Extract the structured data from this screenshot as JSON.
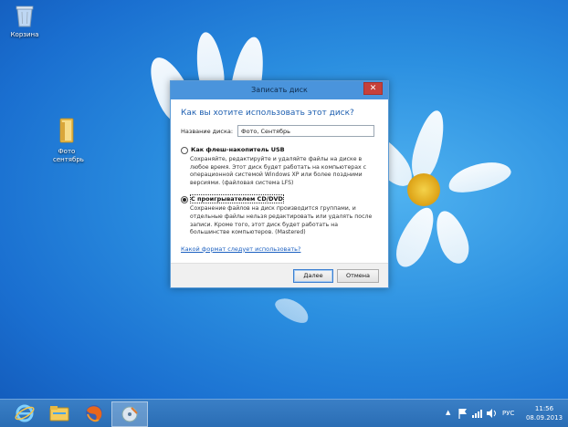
{
  "desktop": {
    "icons": [
      {
        "label": "Корзина",
        "icon": "recycle-bin-icon"
      },
      {
        "label": "Фото сентябрь",
        "icon": "folder-icon"
      }
    ]
  },
  "dialog": {
    "title": "Записать диск",
    "close_label": "✕",
    "heading": "Как вы хотите использовать этот диск?",
    "disc_name_label": "Название диска:",
    "disc_name_value": "Фото, Сентябрь",
    "option_usb": {
      "title": "Как флеш-накопитель USB",
      "description": "Сохраняйте, редактируйте и удаляйте файлы на диске в любое время. Этот диск будет работать на компьютерах с операционной системой Windows XP или более поздними версиями. (файловая система LFS)",
      "selected": false
    },
    "option_cd": {
      "title": "С проигрывателем CD/DVD",
      "description": "Сохранение файлов на диск производится группами, и отдельные файлы нельзя редактировать или удалять после записи. Кроме того, этот диск будет работать на большинстве компьютеров. (Mastered)",
      "selected": true
    },
    "help_link": "Какой формат следует использовать?",
    "next_label": "Далее",
    "cancel_label": "Отмена"
  },
  "taskbar": {
    "items": [
      "internet-explorer-icon",
      "file-explorer-icon",
      "firefox-icon",
      "burn-disc-icon"
    ],
    "language": "РУС",
    "time": "11:56",
    "date": "08.09.2013"
  }
}
